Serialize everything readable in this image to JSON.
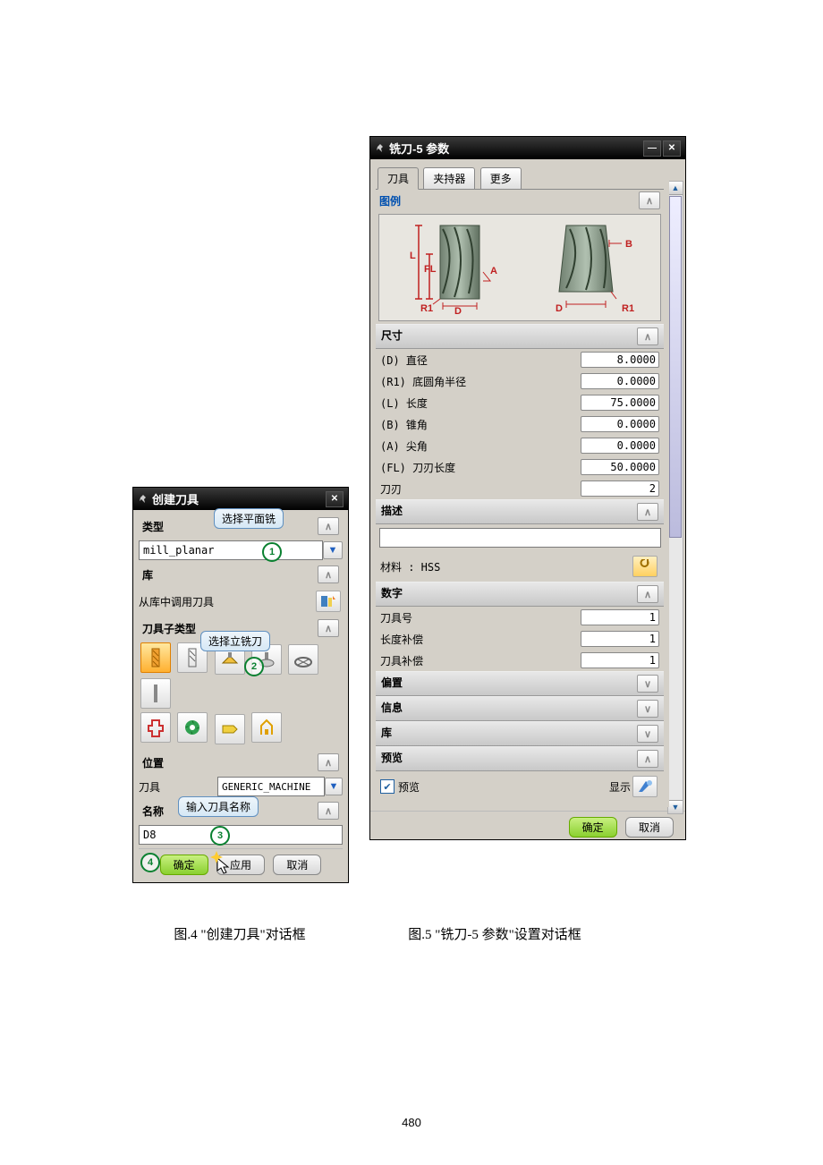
{
  "pageNumber": "480",
  "captions": {
    "left": "图.4  \"创建刀具\"对话框",
    "right": "图.5  \"铣刀-5 参数\"设置对话框"
  },
  "dialog1": {
    "title": "创建刀具",
    "sections": {
      "type": "类型",
      "lib": "库",
      "libAction": "从库中调用刀具",
      "subtype": "刀具子类型",
      "pos": "位置",
      "posLabel": "刀具",
      "name": "名称"
    },
    "typeValue": "mill_planar",
    "posValue": "GENERIC_MACHINE",
    "nameValue": "D8",
    "callouts": {
      "c1": "选择平面铣",
      "c2": "选择立铣刀",
      "c3": "输入刀具名称"
    },
    "buttons": {
      "ok": "确定",
      "apply": "应用",
      "cancel": "取消"
    }
  },
  "dialog2": {
    "title": "铣刀-5 参数",
    "tabs": {
      "tool": "刀具",
      "holder": "夹持器",
      "more": "更多"
    },
    "legend": "图例",
    "diagramLabels": {
      "L": "L",
      "FL": "FL",
      "R1": "R1",
      "D": "D",
      "A": "A",
      "B": "B"
    },
    "sizeHeader": "尺寸",
    "fields": {
      "d": {
        "label": "(D) 直径",
        "value": "8.0000"
      },
      "r1": {
        "label": "(R1) 底圆角半径",
        "value": "0.0000"
      },
      "l": {
        "label": "(L) 长度",
        "value": "75.0000"
      },
      "b": {
        "label": "(B) 锥角",
        "value": "0.0000"
      },
      "a": {
        "label": "(A) 尖角",
        "value": "0.0000"
      },
      "fl": {
        "label": "(FL) 刀刃长度",
        "value": "50.0000"
      },
      "edges": {
        "label": "刀刃",
        "value": "2"
      }
    },
    "descHeader": "描述",
    "material": "材料 : HSS",
    "numHeader": "数字",
    "numFields": {
      "toolNo": {
        "label": "刀具号",
        "value": "1"
      },
      "lenComp": {
        "label": "长度补偿",
        "value": "1"
      },
      "toolComp": {
        "label": "刀具补偿",
        "value": "1"
      }
    },
    "collapsedSections": {
      "offset": "偏置",
      "info": "信息",
      "lib": "库"
    },
    "previewHeader": "预览",
    "previewCheck": "预览",
    "display": "显示",
    "buttons": {
      "ok": "确定",
      "cancel": "取消"
    }
  }
}
